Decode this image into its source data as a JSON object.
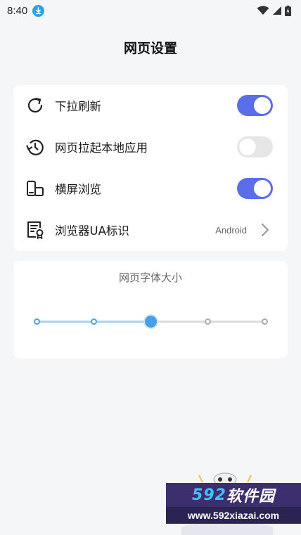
{
  "status_bar": {
    "time": "8:40",
    "icons": [
      "download-icon",
      "wifi-icon",
      "signal-icon",
      "battery-charging-icon"
    ]
  },
  "page": {
    "title": "网页设置"
  },
  "settings": [
    {
      "label": "下拉刷新",
      "icon": "refresh-icon",
      "type": "toggle",
      "on": true
    },
    {
      "label": "网页拉起本地应用",
      "icon": "history-icon",
      "type": "toggle",
      "on": false
    },
    {
      "label": "横屏浏览",
      "icon": "phone-rotate-icon",
      "type": "toggle",
      "on": true
    },
    {
      "label": "浏览器UA标识",
      "icon": "certificate-icon",
      "type": "select",
      "value": "Android"
    }
  ],
  "font_size": {
    "title": "网页字体大小",
    "levels": 5,
    "selected_index": 2
  },
  "watermark": {
    "brand_num": "592",
    "brand_text": "软件园",
    "url": "www.592xiazai.com"
  },
  "colors": {
    "toggle_on": "#5b6ee9",
    "toggle_off": "#e6e6e6",
    "slider_active": "#4aa0e6"
  }
}
